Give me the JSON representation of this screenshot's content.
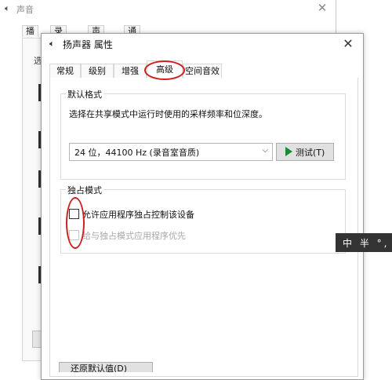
{
  "background_window": {
    "title": "声音",
    "close_glyph": "✕",
    "tabs": [
      {
        "label": "播放"
      },
      {
        "label": "录制"
      },
      {
        "label": "声音"
      },
      {
        "label": "通信"
      }
    ],
    "content_label": "选"
  },
  "dialog": {
    "title": "扬声器 属性",
    "close_glyph": "✕",
    "tabs": [
      {
        "label": "常规"
      },
      {
        "label": "级别"
      },
      {
        "label": "增强"
      },
      {
        "label": "高级"
      },
      {
        "label": "空间音效"
      }
    ],
    "active_tab": "高级",
    "default_format": {
      "title": "默认格式",
      "description": "选择在共享模式中运行时使用的采样频率和位深度。",
      "selected_format": "24 位，44100 Hz (录音室音质)",
      "test_button_label": "测试(T)"
    },
    "exclusive_mode": {
      "title": "独占模式",
      "allow_exclusive_label": "允许应用程序独占控制该设备",
      "allow_exclusive_checked": false,
      "priority_label": "给与独占模式应用程序优先",
      "priority_checked": false,
      "priority_enabled": false
    },
    "restore_defaults_label": "还原默认值(D)"
  },
  "ime_toolbar": {
    "text": "中 半 °, ⌨"
  },
  "colors": {
    "annotation": "#cc2020",
    "play_icon": "#1e8a2e",
    "ime_background": "#333333"
  },
  "icons": {
    "background_window": "speaker-icon",
    "dialog": "speaker-icon",
    "test_button": "play-icon"
  }
}
